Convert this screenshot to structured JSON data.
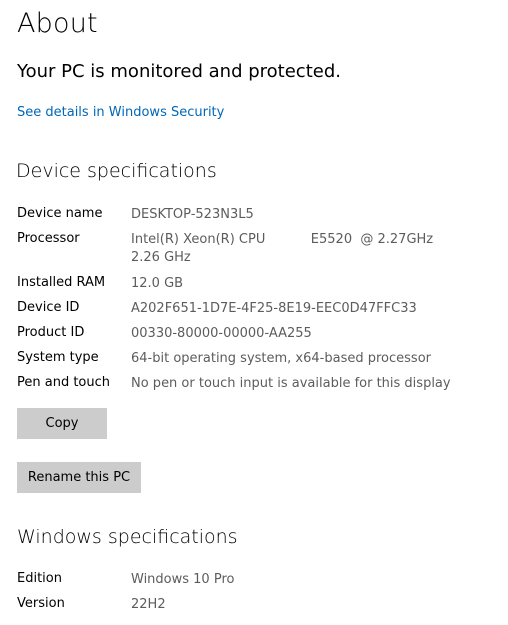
{
  "page_title": "About",
  "status": "Your PC is monitored and protected.",
  "security_link": "See details in Windows Security",
  "device_section": {
    "title": "Device specifications",
    "rows": [
      {
        "label": "Device name",
        "value": "DESKTOP-523N3L5"
      },
      {
        "label": "Processor",
        "value": "Intel(R) Xeon(R) CPU           E5520  @ 2.27GHz   2.26 GHz"
      },
      {
        "label": "Installed RAM",
        "value": "12.0 GB"
      },
      {
        "label": "Device ID",
        "value": "A202F651-1D7E-4F25-8E19-EEC0D47FFC33"
      },
      {
        "label": "Product ID",
        "value": "00330-80000-00000-AA255"
      },
      {
        "label": "System type",
        "value": "64-bit operating system, x64-based processor"
      },
      {
        "label": "Pen and touch",
        "value": "No pen or touch input is available for this display"
      }
    ],
    "copy_label": "Copy",
    "rename_label": "Rename this PC"
  },
  "windows_section": {
    "title": "Windows specifications",
    "rows": [
      {
        "label": "Edition",
        "value": "Windows 10 Pro"
      },
      {
        "label": "Version",
        "value": "22H2"
      }
    ]
  }
}
